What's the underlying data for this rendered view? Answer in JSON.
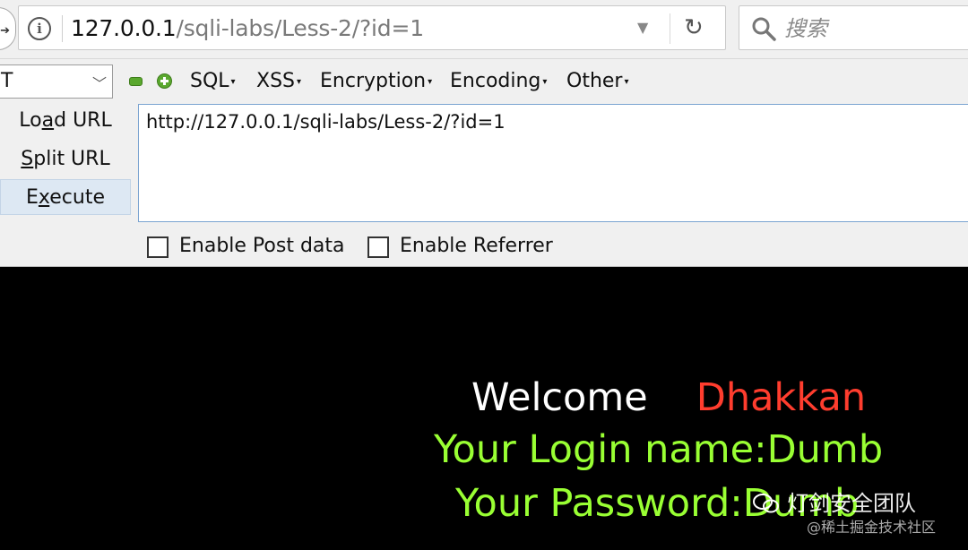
{
  "address_bar": {
    "url_host": "127.0.0.1",
    "url_path": "/sqli-labs/Less-2/?id=1",
    "search_placeholder": "搜索"
  },
  "hackbar": {
    "method": "T",
    "menus": [
      {
        "label": "SQL"
      },
      {
        "label": "XSS"
      },
      {
        "label": "Encryption"
      },
      {
        "label": "Encoding"
      },
      {
        "label": "Other"
      }
    ],
    "actions": {
      "load_pre": "Lo",
      "load_ul": "a",
      "load_post": "d URL",
      "split_ul": "S",
      "split_post": "plit URL",
      "exec_pre": "E",
      "exec_ul": "x",
      "exec_post": "ecute"
    },
    "url_value": "http://127.0.0.1/sqli-labs/Less-2/?id=1",
    "enable_post_label": "Enable Post data",
    "enable_referrer_label": "Enable Referrer"
  },
  "page": {
    "welcome": "Welcome",
    "name": "Dhakkan",
    "login_line": "Your Login name:Dumb",
    "password_line": "Your Password:Dumb"
  },
  "watermark": {
    "team": "灯剑安全团队",
    "community": "@稀土掘金技术社区"
  },
  "colors": {
    "welcome": "#ffffff",
    "name": "#ff3d2e",
    "result": "#99ff33",
    "page_background": "#000000"
  }
}
